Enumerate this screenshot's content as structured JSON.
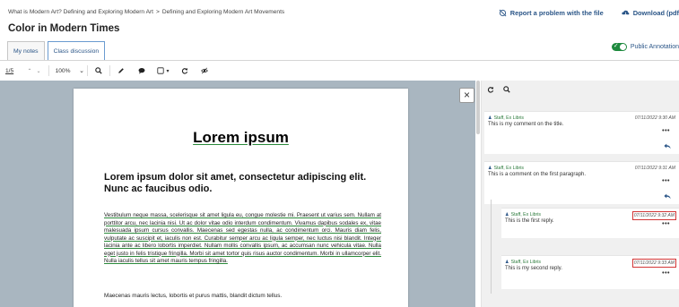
{
  "breadcrumb": {
    "part1": "What is Modern Art? Defining and Exploring Modern Art",
    "separator": ">",
    "part2": "Defining and Exploring Modern Art Movements"
  },
  "header_links": {
    "report": "Report a problem with the file",
    "download": "Download (pdf"
  },
  "title": "Color in Modern Times",
  "tabs": [
    {
      "label": "My notes",
      "active": false
    },
    {
      "label": "Class discussion",
      "active": true
    }
  ],
  "public_annotation_label": "Public Annotation",
  "public_annotation_on": true,
  "toolbar": {
    "page": "1/5",
    "zoom": "100%"
  },
  "document": {
    "title": "Lorem ipsum",
    "subtitle": "Lorem ipsum dolor sit amet, consectetur adipiscing elit. Nunc ac faucibus odio.",
    "paragraph": "Vestibulum neque massa, scelerisque sit amet ligula eu, congue molestie mi. Praesent ut varius sem. Nullam at porttitor arcu, nec lacinia nisi. Ut ac dolor vitae odio interdum condimentum. Vivamus dapibus sodales ex, vitae malesuada ipsum cursus convallis. Maecenas sed egestas nulla, ac condimentum orci. Mauris diam felis, vulputate ac suscipit et, iaculis non est. Curabitur semper arcu ac ligula semper, nec luctus nisi blandit. Integer lacinia ante ac libero lobortis imperdiet. Nullam mollis convallis ipsum, ac accumsan nunc vehicula vitae. Nulla eget justo in felis tristique fringilla. Morbi sit amet tortor quis risus auctor condimentum. Morbi in ullamcorper elit. Nulla iaculis tellus sit amet mauris tempus fringilla.",
    "paragraph2": "Maecenas mauris lectus, lobortis et purus mattis, blandit dictum tellus."
  },
  "annotations": [
    {
      "author": "Staff, Ex Libris",
      "date": "07/11/2022 9:30 AM",
      "text": "This is my comment on the title.",
      "highlighted": false
    },
    {
      "author": "Staff, Ex Libris",
      "date": "07/11/2022 9:31 AM",
      "text": "This is a comment on the first paragraph.",
      "highlighted": false
    },
    {
      "author": "Staff, Ex Libris",
      "date": "07/11/2022 9:32 AM",
      "text": "This is the first reply.",
      "highlighted": true
    },
    {
      "author": "Staff, Ex Libris",
      "date": "07/11/2022 9:33 AM",
      "text": "This is my second reply.",
      "highlighted": true
    }
  ],
  "colors": {
    "link_blue": "#2a5587",
    "green": "#1e8a3e",
    "highlight_red": "#d23535",
    "viewer_bg": "#a9b6c0"
  }
}
